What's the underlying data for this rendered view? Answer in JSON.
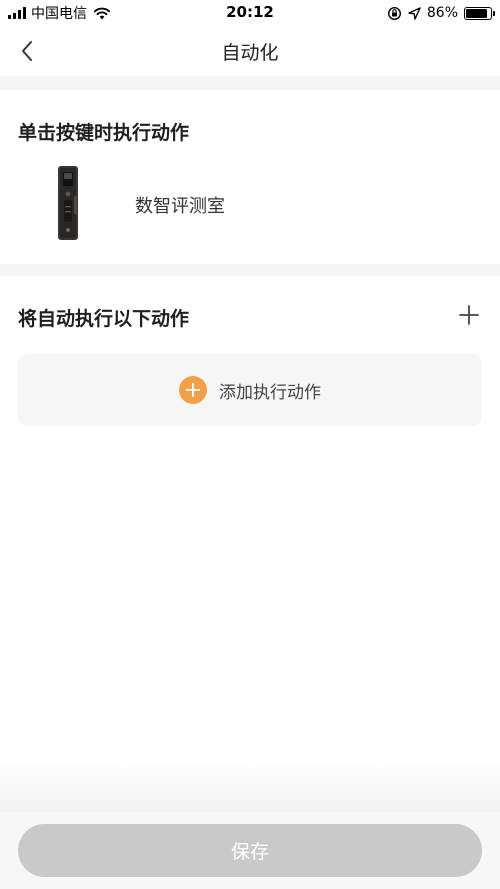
{
  "status_bar": {
    "carrier": "中国电信",
    "time": "20:12",
    "battery_percent": "86%",
    "battery_level": 0.86,
    "icons": [
      "signal-icon",
      "wifi-icon",
      "rotation-lock-icon",
      "location-icon",
      "battery-icon"
    ]
  },
  "nav": {
    "title": "自动化",
    "back_icon": "chevron-left-icon"
  },
  "trigger_section": {
    "title": "单击按键时执行动作",
    "device": {
      "name": "数智评测室",
      "image_icon": "smart-lock-icon"
    }
  },
  "action_section": {
    "title": "将自动执行以下动作",
    "plus_icon": "plus-icon",
    "add_action_label": "添加执行动作"
  },
  "footer": {
    "save_label": "保存"
  },
  "colors": {
    "accent_orange": "#f2a04a",
    "save_disabled": "#c9c9c9",
    "divider_band": "#f5f5f5",
    "card_bg": "#f6f6f6"
  }
}
